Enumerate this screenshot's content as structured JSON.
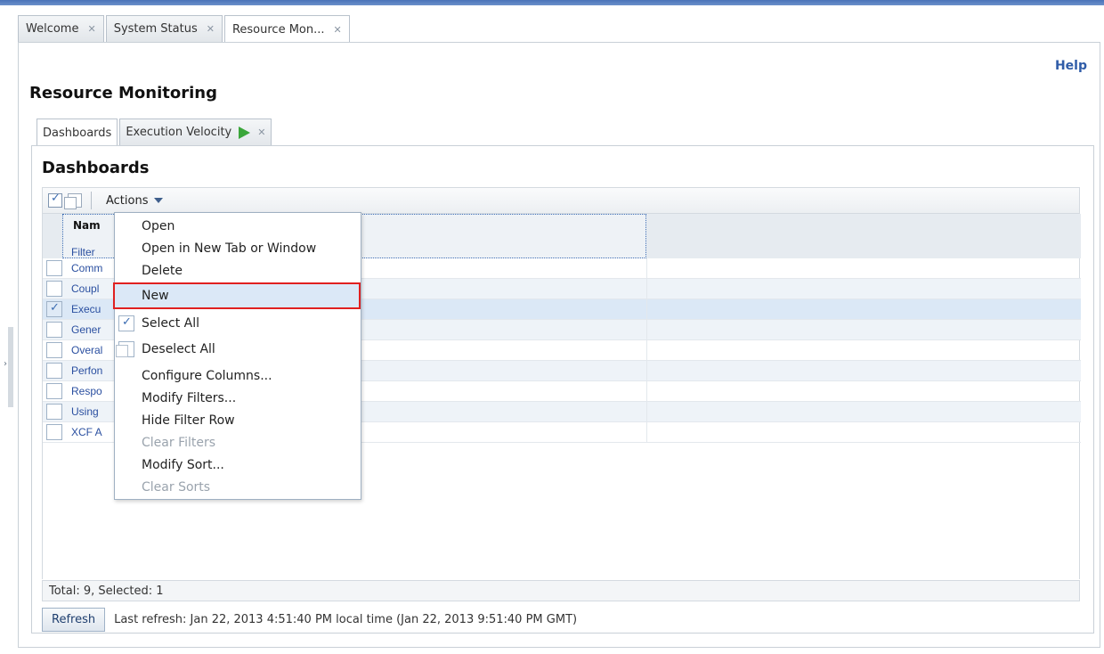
{
  "outer_tabs": [
    {
      "label": "Welcome",
      "close": "✕"
    },
    {
      "label": "System Status",
      "close": "✕"
    },
    {
      "label": "Resource Mon...",
      "close": "✕"
    }
  ],
  "help": "Help",
  "page_title": "Resource Monitoring",
  "inner_tabs": [
    {
      "label": "Dashboards"
    },
    {
      "label": "Execution Velocity",
      "close": "✕"
    }
  ],
  "panel_title": "Dashboards",
  "toolbar": {
    "actions_label": "Actions"
  },
  "grid": {
    "name_header": "Nam",
    "filter_label": "Filter",
    "rows": [
      {
        "name": "Comm",
        "checked": false
      },
      {
        "name": "Coupl",
        "checked": false
      },
      {
        "name": "Execu",
        "checked": true
      },
      {
        "name": "Gener",
        "checked": false
      },
      {
        "name": "Overal",
        "checked": false
      },
      {
        "name": "Perfon",
        "checked": false
      },
      {
        "name": "Respo",
        "checked": false
      },
      {
        "name": "Using",
        "checked": false
      },
      {
        "name": "XCF A",
        "checked": false
      }
    ]
  },
  "status": "Total: 9, Selected: 1",
  "refresh": {
    "button": "Refresh",
    "text": "Last refresh: Jan 22, 2013 4:51:40 PM local time (Jan 22, 2013 9:51:40 PM GMT)"
  },
  "menu": {
    "items": [
      {
        "label": "Open",
        "disabled": false
      },
      {
        "label": "Open in New Tab or Window",
        "disabled": false
      },
      {
        "label": "Delete",
        "disabled": false
      },
      {
        "label": "New",
        "disabled": false,
        "highlighted": true
      },
      {
        "label": "Select All",
        "disabled": false
      },
      {
        "label": "Deselect All",
        "disabled": false
      },
      {
        "label": "Configure Columns...",
        "disabled": false
      },
      {
        "label": "Modify Filters...",
        "disabled": false
      },
      {
        "label": "Hide Filter Row",
        "disabled": false
      },
      {
        "label": "Clear Filters",
        "disabled": true
      },
      {
        "label": "Modify Sort...",
        "disabled": false
      },
      {
        "label": "Clear Sorts",
        "disabled": true
      }
    ]
  },
  "colors": {
    "accent": "#2f5ca8",
    "highlight_border": "#e02020",
    "play": "#3aa63a"
  }
}
